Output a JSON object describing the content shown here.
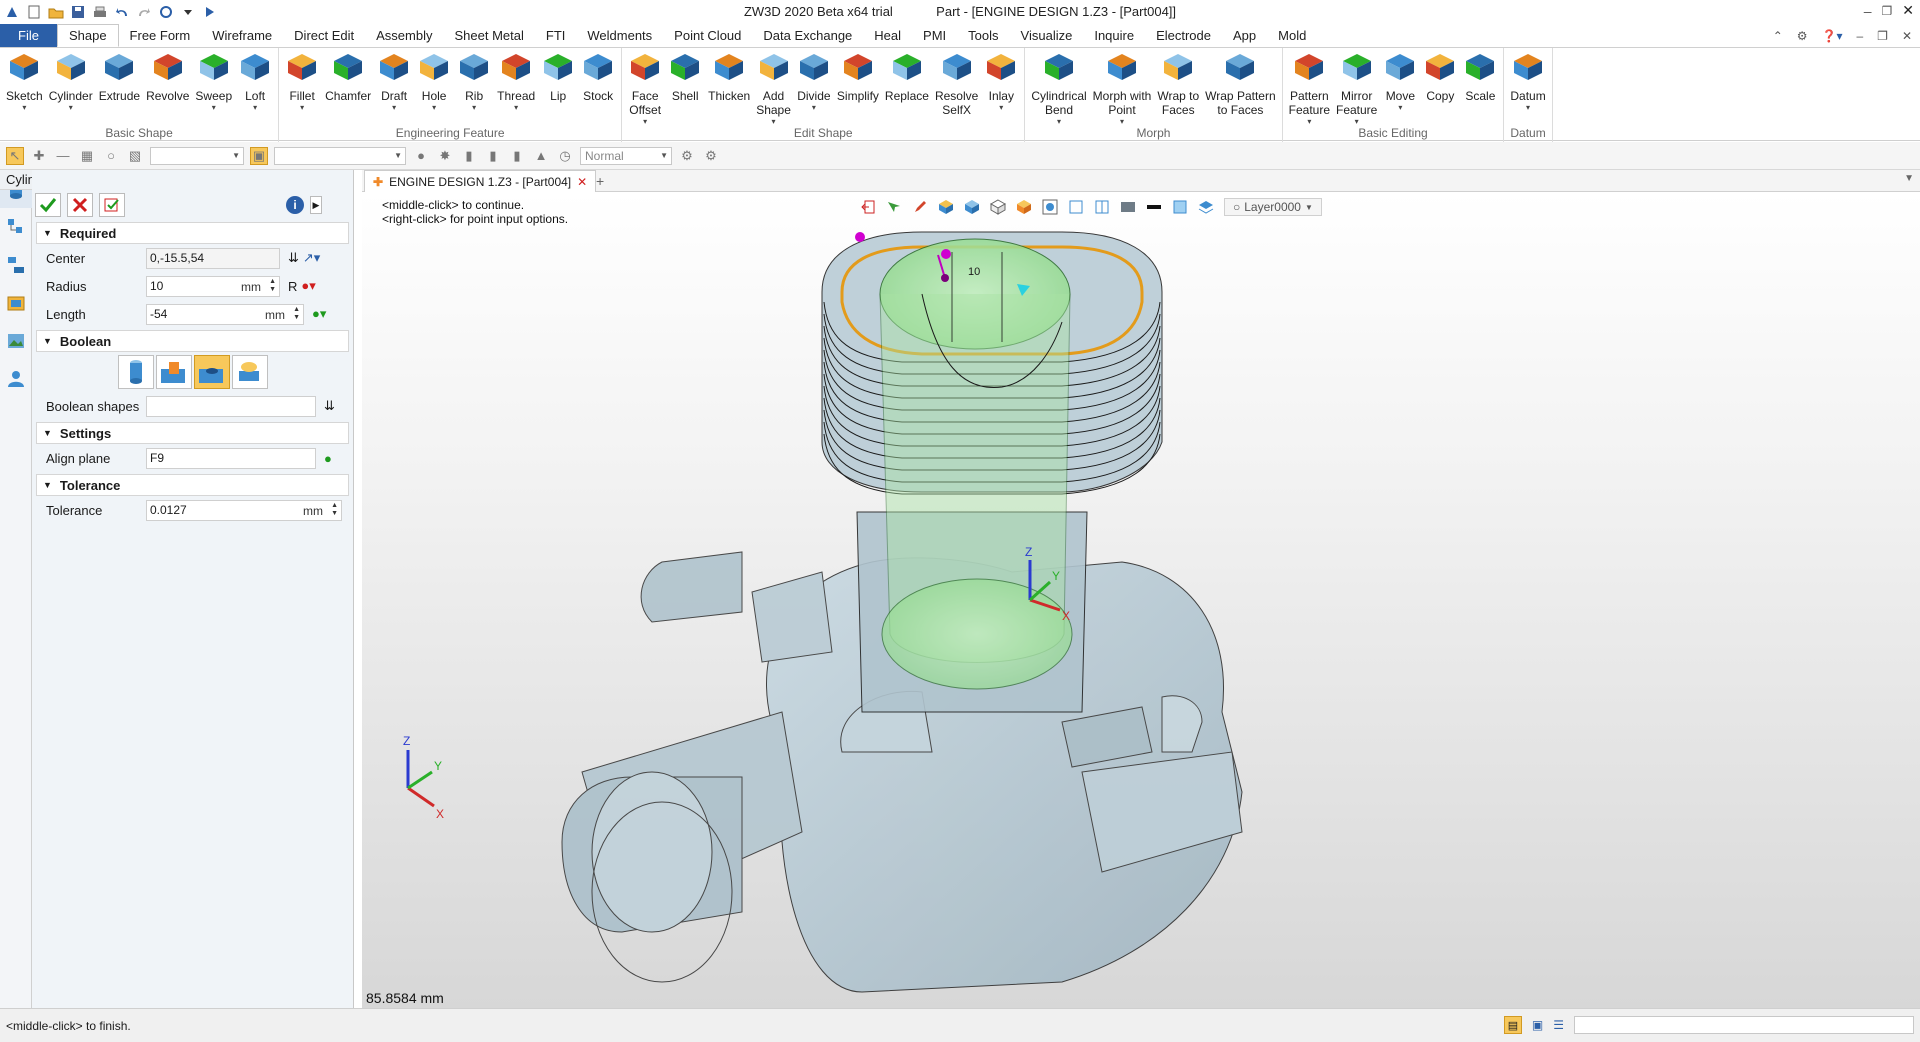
{
  "window": {
    "title": "ZW3D 2020 Beta x64 trial",
    "doc_title": "Part - [ENGINE DESIGN 1.Z3 - [Part004]]"
  },
  "menu_tabs": [
    "File",
    "Shape",
    "Free Form",
    "Wireframe",
    "Direct Edit",
    "Assembly",
    "Sheet Metal",
    "FTI",
    "Weldments",
    "Point Cloud",
    "Data Exchange",
    "Heal",
    "PMI",
    "Tools",
    "Visualize",
    "Inquire",
    "Electrode",
    "App",
    "Mold"
  ],
  "ribbon": {
    "groups": [
      {
        "name": "Basic Shape",
        "buttons": [
          {
            "l1": "Sketch",
            "l2": "",
            "dd": true
          },
          {
            "l1": "Cylinder",
            "l2": "",
            "dd": true
          },
          {
            "l1": "Extrude",
            "l2": "",
            "dd": false
          },
          {
            "l1": "Revolve",
            "l2": "",
            "dd": false
          },
          {
            "l1": "Sweep",
            "l2": "",
            "dd": true
          },
          {
            "l1": "Loft",
            "l2": "",
            "dd": true
          }
        ]
      },
      {
        "name": "Engineering Feature",
        "buttons": [
          {
            "l1": "Fillet",
            "l2": "",
            "dd": true
          },
          {
            "l1": "Chamfer",
            "l2": "",
            "dd": false
          },
          {
            "l1": "Draft",
            "l2": "",
            "dd": true
          },
          {
            "l1": "Hole",
            "l2": "",
            "dd": true
          },
          {
            "l1": "Rib",
            "l2": "",
            "dd": true
          },
          {
            "l1": "Thread",
            "l2": "",
            "dd": true
          },
          {
            "l1": "Lip",
            "l2": "",
            "dd": false
          },
          {
            "l1": "Stock",
            "l2": "",
            "dd": false
          }
        ]
      },
      {
        "name": "Edit Shape",
        "buttons": [
          {
            "l1": "Face",
            "l2": "Offset",
            "dd": true
          },
          {
            "l1": "Shell",
            "l2": "",
            "dd": false
          },
          {
            "l1": "Thicken",
            "l2": "",
            "dd": false
          },
          {
            "l1": "Add",
            "l2": "Shape",
            "dd": true
          },
          {
            "l1": "Divide",
            "l2": "",
            "dd": true
          },
          {
            "l1": "Simplify",
            "l2": "",
            "dd": false
          },
          {
            "l1": "Replace",
            "l2": "",
            "dd": false
          },
          {
            "l1": "Resolve",
            "l2": "SelfX",
            "dd": false
          },
          {
            "l1": "Inlay",
            "l2": "",
            "dd": true
          }
        ]
      },
      {
        "name": "Morph",
        "buttons": [
          {
            "l1": "Cylindrical",
            "l2": "Bend",
            "dd": true
          },
          {
            "l1": "Morph with",
            "l2": "Point",
            "dd": true
          },
          {
            "l1": "Wrap to",
            "l2": "Faces",
            "dd": false
          },
          {
            "l1": "Wrap Pattern",
            "l2": "to Faces",
            "dd": false
          }
        ]
      },
      {
        "name": "Basic Editing",
        "buttons": [
          {
            "l1": "Pattern",
            "l2": "Feature",
            "dd": true
          },
          {
            "l1": "Mirror",
            "l2": "Feature",
            "dd": true
          },
          {
            "l1": "Move",
            "l2": "",
            "dd": true
          },
          {
            "l1": "Copy",
            "l2": "",
            "dd": false
          },
          {
            "l1": "Scale",
            "l2": "",
            "dd": false
          }
        ]
      },
      {
        "name": "Datum",
        "buttons": [
          {
            "l1": "Datum",
            "l2": "",
            "dd": true
          }
        ]
      }
    ]
  },
  "toolbar2": {
    "render_mode": "Normal"
  },
  "panel": {
    "title": "Cylinder",
    "required": {
      "header": "Required",
      "center_label": "Center",
      "center_value": "0,-15.5,54",
      "radius_label": "Radius",
      "radius_value": "10",
      "radius_unit": "mm",
      "radius_side": "R",
      "length_label": "Length",
      "length_value": "-54",
      "length_unit": "mm"
    },
    "boolean": {
      "header": "Boolean",
      "shapes_label": "Boolean shapes",
      "shapes_value": ""
    },
    "settings": {
      "header": "Settings",
      "align_label": "Align plane",
      "align_value": "F9"
    },
    "tolerance": {
      "header": "Tolerance",
      "tol_label": "Tolerance",
      "tol_value": "0.0127",
      "tol_unit": "mm"
    }
  },
  "document": {
    "tab_label": "ENGINE DESIGN 1.Z3 - [Part004]"
  },
  "viewport": {
    "hint1": "<middle-click> to continue.",
    "hint2": "<right-click> for point input options.",
    "layer": "Layer0000",
    "measurement": "85.8584 mm",
    "dim_label": "10",
    "axis": {
      "x": "X",
      "y": "Y",
      "z": "Z"
    }
  },
  "status": {
    "text": "<middle-click> to finish."
  },
  "colors": {
    "accent": "#2b5fa8",
    "highlight": "#f7c85b",
    "part": "#b9ccd6",
    "selection": "#9fe39a",
    "edge": "#e39b1b"
  }
}
